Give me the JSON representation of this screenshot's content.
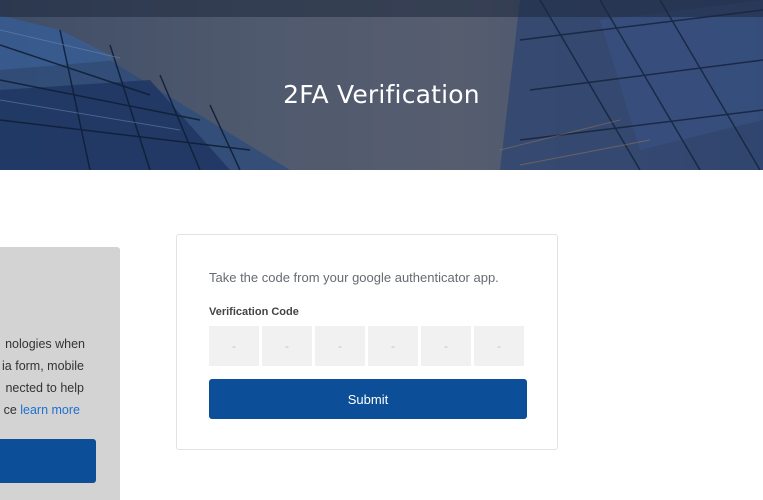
{
  "hero": {
    "title": "2FA Verification"
  },
  "cookie_notice": {
    "lines": [
      "nologies when",
      "ia form, mobile",
      "nected to help",
      "ce "
    ],
    "link_text": "learn more",
    "button_label": ""
  },
  "verification": {
    "instruction": "Take the code from your google authenticator app.",
    "code_label": "Verification Code",
    "digit_placeholders": [
      "-",
      "-",
      "-",
      "-",
      "-",
      "-"
    ],
    "submit_label": "Submit"
  },
  "colors": {
    "primary": "#0c4e97",
    "link": "#1f6fd1",
    "panel_gray": "#d3d3d3",
    "input_gray": "#f1f1f1"
  }
}
